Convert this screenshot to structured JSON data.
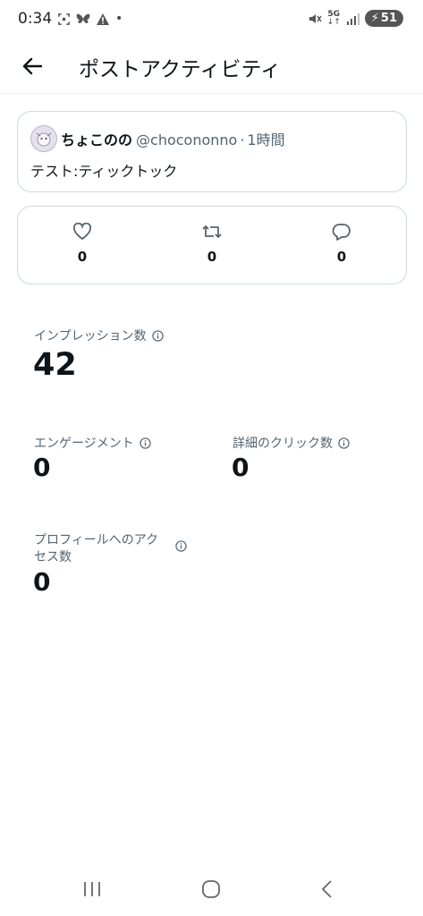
{
  "status_bar": {
    "time": "0:34",
    "network": "5G",
    "battery": "51"
  },
  "header": {
    "title": "ポストアクティビティ"
  },
  "post": {
    "name": "ちょこのの",
    "handle": "@chocononno",
    "separator": "·",
    "time": "1時間",
    "text": "テスト:ティックトック"
  },
  "engagement": {
    "likes": "0",
    "reposts": "0",
    "replies": "0"
  },
  "stats": {
    "impressions_label": "インプレッション数",
    "impressions_value": "42",
    "engagements_label": "エンゲージメント",
    "engagements_value": "0",
    "detail_clicks_label": "詳細のクリック数",
    "detail_clicks_value": "0",
    "profile_visits_label": "プロフィールへのアクセス数",
    "profile_visits_value": "0"
  },
  "icons": [
    "back-arrow-icon",
    "heart-icon",
    "repost-icon",
    "reply-icon",
    "info-icon",
    "recent-apps-icon",
    "home-icon",
    "nav-back-icon"
  ],
  "colors": {
    "text": "#0f1419",
    "secondary": "#536471",
    "border": "#cfd9de"
  }
}
